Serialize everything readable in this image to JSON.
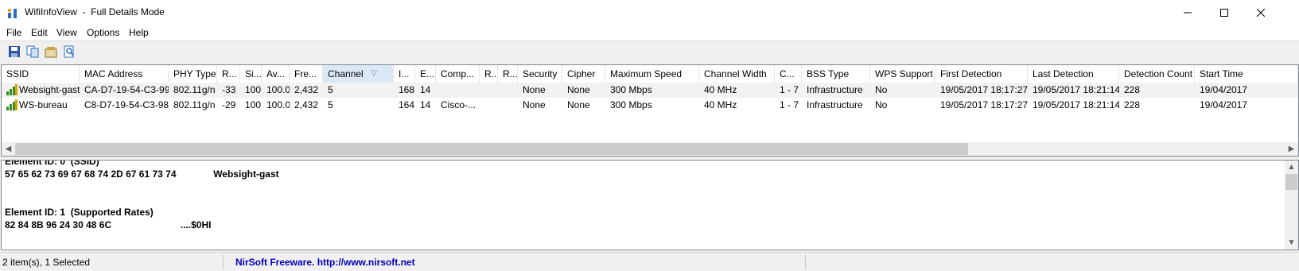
{
  "window": {
    "title": "WifiInfoView  -  Full Details Mode"
  },
  "menu": [
    "File",
    "Edit",
    "View",
    "Options",
    "Help"
  ],
  "toolbar": {
    "icons": [
      "save-icon",
      "copy-icon",
      "properties-icon",
      "find-icon"
    ]
  },
  "list": {
    "columns": [
      {
        "label": "SSID"
      },
      {
        "label": "MAC Address"
      },
      {
        "label": "PHY Type"
      },
      {
        "label": "R..."
      },
      {
        "label": "Si..."
      },
      {
        "label": "Av..."
      },
      {
        "label": "Fre..."
      },
      {
        "label": "Channel",
        "sorted": true
      },
      {
        "label": "I..."
      },
      {
        "label": "E..."
      },
      {
        "label": "Comp..."
      },
      {
        "label": "R..."
      },
      {
        "label": "R..."
      },
      {
        "label": "Security"
      },
      {
        "label": "Cipher"
      },
      {
        "label": "Maximum Speed"
      },
      {
        "label": "Channel Width"
      },
      {
        "label": "C..."
      },
      {
        "label": "BSS Type"
      },
      {
        "label": "WPS Support"
      },
      {
        "label": "First Detection"
      },
      {
        "label": "Last Detection"
      },
      {
        "label": "Detection Count"
      },
      {
        "label": "Start Time"
      }
    ],
    "rows": [
      {
        "selected": true,
        "cells": [
          "Websight-gast",
          "CA-D7-19-54-C3-99",
          "802.11g/n",
          "-33",
          "100",
          "100.0",
          "2,432",
          "5",
          "168",
          "14",
          "",
          "",
          "",
          "None",
          "None",
          "300 Mbps",
          "40 MHz",
          "1 - 7",
          "Infrastructure",
          "No",
          "19/05/2017 18:17:27",
          "19/05/2017 18:21:14",
          "228",
          "19/04/2017"
        ]
      },
      {
        "selected": false,
        "cells": [
          "WS-bureau",
          "C8-D7-19-54-C3-98",
          "802.11g/n",
          "-29",
          "100",
          "100.0",
          "2,432",
          "5",
          "164",
          "14",
          "Cisco-...",
          "",
          "",
          "None",
          "None",
          "300 Mbps",
          "40 MHz",
          "1 - 7",
          "Infrastructure",
          "No",
          "19/05/2017 18:17:27",
          "19/05/2017 18:21:14",
          "228",
          "19/04/2017"
        ]
      }
    ]
  },
  "details": {
    "lines": [
      "Element ID: 0  (SSID)",
      "57 65 62 73 69 67 68 74 2D 67 61 73 74              Websight-gast",
      "",
      "",
      "Element ID: 1  (Supported Rates)",
      "82 84 8B 96 24 30 48 6C                          ....$0HI"
    ]
  },
  "status": {
    "items": "2 item(s), 1 Selected",
    "credit": "NirSoft Freeware.  http://www.nirsoft.net",
    "credit_color": "#0000c0"
  }
}
